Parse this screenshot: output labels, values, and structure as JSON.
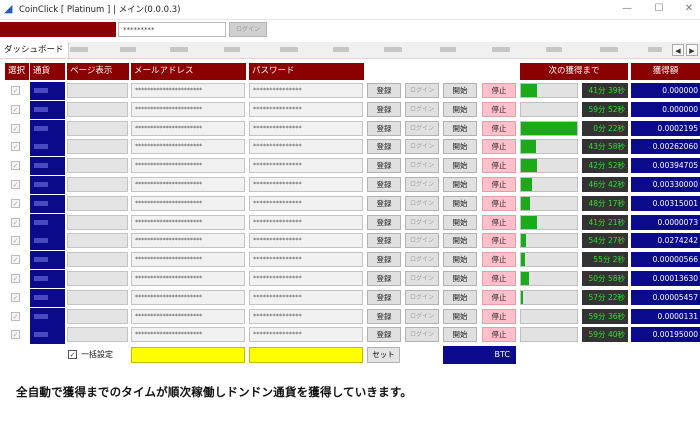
{
  "window": {
    "title": "CoinClick [ Platinum ] | メイン(0.0.0.3)",
    "minimize": "—",
    "maximize": "☐",
    "close": "✕"
  },
  "topbar": {
    "password_mask": "*********",
    "login_label": "ログイン"
  },
  "tabs": {
    "dashboard": "ダッシュボード",
    "prev_arrow": "◀",
    "next_arrow": "▶"
  },
  "headers": {
    "select": "選択",
    "currency": "通貨",
    "page_view": "ページ表示",
    "email": "メールアドレス",
    "password": "パスワード",
    "next_until": "次の獲得まで",
    "amount": "獲得額"
  },
  "row_buttons": {
    "register": "登録",
    "login": "ログイン",
    "start": "開始",
    "stop": "停止"
  },
  "masks": {
    "email": "**********************",
    "password": "***************"
  },
  "rows": [
    {
      "progress": 0.28,
      "time": "41分 39秒",
      "amount": "0.000000"
    },
    {
      "progress": 0.0,
      "time": "59分 52秒",
      "amount": "0.000000"
    },
    {
      "progress": 1.0,
      "time": "0分 22秒",
      "amount": "0.0002195"
    },
    {
      "progress": 0.26,
      "time": "43分 58秒",
      "amount": "0.00262060"
    },
    {
      "progress": 0.28,
      "time": "42分 52秒",
      "amount": "0.00394705"
    },
    {
      "progress": 0.2,
      "time": "46分 42秒",
      "amount": "0.00330000"
    },
    {
      "progress": 0.16,
      "time": "48分 17秒",
      "amount": "0.00315001"
    },
    {
      "progress": 0.29,
      "time": "41分 21秒",
      "amount": "0.0000073"
    },
    {
      "progress": 0.09,
      "time": "54分 27秒",
      "amount": "0.0274242"
    },
    {
      "progress": 0.07,
      "time": "55分 2秒",
      "amount": "0.00000566"
    },
    {
      "progress": 0.15,
      "time": "50分 58秒",
      "amount": "0.00013630"
    },
    {
      "progress": 0.03,
      "time": "57分 22秒",
      "amount": "0.00005457"
    },
    {
      "progress": 0.0,
      "time": "59分 36秒",
      "amount": "0.0000131"
    },
    {
      "progress": 0.0,
      "time": "59分 40秒",
      "amount": "0.00195000"
    }
  ],
  "bottom": {
    "bulk_label": "一括設定",
    "set_label": "セット",
    "currency": "BTC"
  },
  "footer": "全自動で獲得までのタイムが順次稼働しドンドン通貨を獲得していきます。",
  "colors": {
    "header_red": "#8b0000",
    "coin_blue": "#0a0a8a",
    "progress_green": "#1aaa1a",
    "timer_green": "#2fe02f",
    "stop_pink": "#ffc0cb",
    "bulk_yellow": "#ffff00"
  }
}
